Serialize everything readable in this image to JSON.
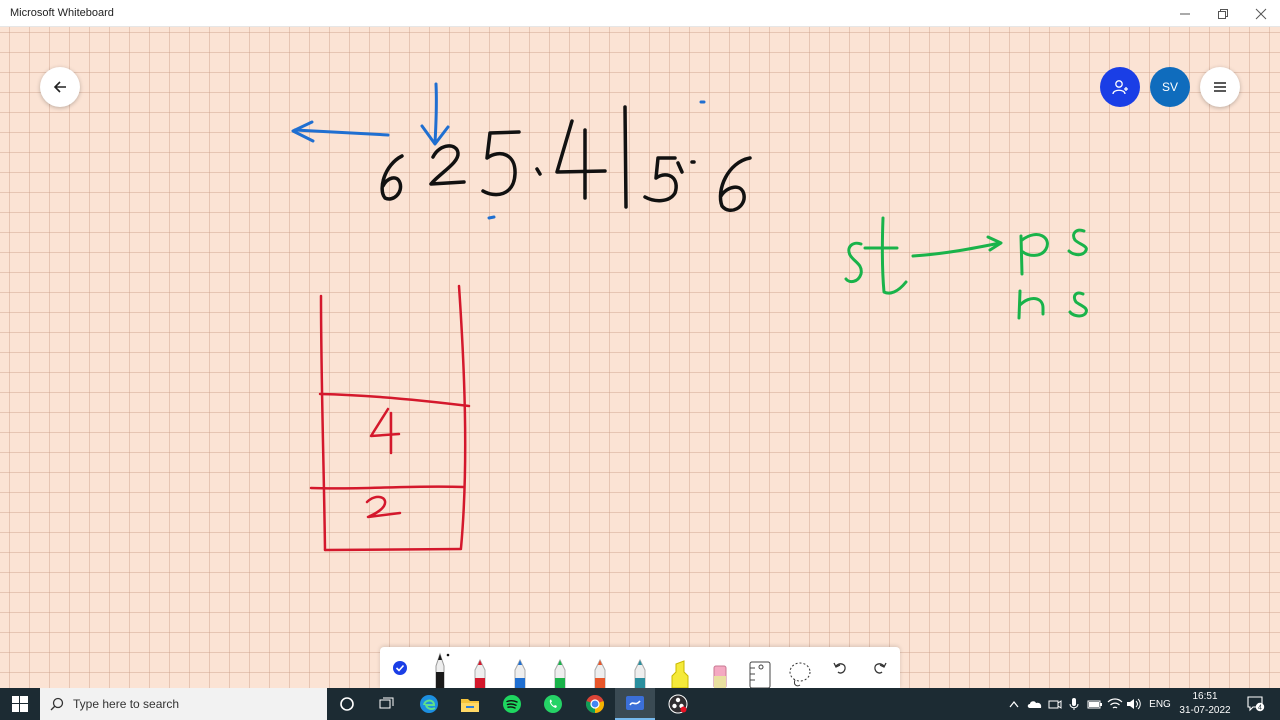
{
  "window": {
    "title": "Microsoft Whiteboard",
    "controls": [
      "minimize",
      "maximize",
      "close"
    ]
  },
  "canvas": {
    "background": "#fbe3d4",
    "grid_color": "#e2b6a4",
    "ink_colors": {
      "blue": "#1f6fd1",
      "black": "#111111",
      "red": "#d4182c",
      "green": "#19b34a"
    }
  },
  "header_buttons": {
    "back": "back-arrow-icon",
    "share": "add-person-icon",
    "avatar_initials": "SV",
    "menu": "hamburger-icon"
  },
  "toolbar": {
    "tools": [
      "ink-to-shape-check",
      "pen-black",
      "pen-red",
      "pen-blue",
      "pen-green",
      "pen-orange",
      "pen-teal",
      "highlighter-yellow",
      "eraser",
      "ruler",
      "lasso-select",
      "undo",
      "redo"
    ]
  },
  "taskbar": {
    "search_placeholder": "Type here to search",
    "apps": [
      "cortana",
      "task-view",
      "edge",
      "file-explorer",
      "spotify",
      "whatsapp",
      "chrome",
      "whiteboard",
      "obs-studio"
    ],
    "language": "ENG",
    "time": "16:51",
    "date": "31-07-2022",
    "notification_count": "4"
  }
}
